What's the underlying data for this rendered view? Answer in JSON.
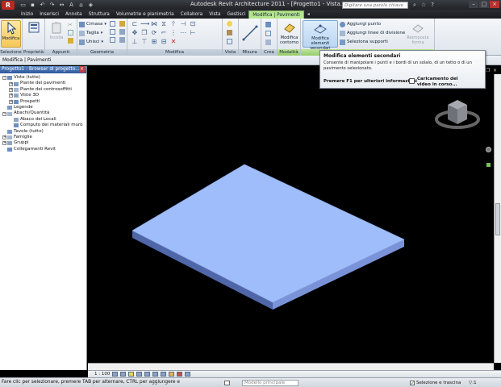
{
  "window": {
    "title": "Autodesk Revit Architecture 2011 - [Progetto1 - Vista...",
    "search_placeholder": "Digitare una parola chiave o una frase",
    "app_logo": "R"
  },
  "tabs": [
    {
      "label": "Inizio",
      "active": false
    },
    {
      "label": "Inserisci",
      "active": false
    },
    {
      "label": "Annota",
      "active": false
    },
    {
      "label": "Struttura",
      "active": false
    },
    {
      "label": "Volumetrie e planimetria",
      "active": false
    },
    {
      "label": "Collabora",
      "active": false
    },
    {
      "label": "Vista",
      "active": false
    },
    {
      "label": "Gestisci",
      "active": false
    },
    {
      "label": "Modifica | Pavimenti",
      "active": true
    }
  ],
  "ribbon": {
    "modifica_button": "Modifica",
    "panels": {
      "selezione": "Selezione",
      "proprieta": "Proprietà",
      "appunti": "Appunti",
      "geometria": "Geometria",
      "modifica": "Modifica",
      "vista": "Vista",
      "misura": "Misura",
      "crea": "Crea",
      "modalita": "Modalità"
    },
    "incolla_label": "Incolla",
    "geometry_items": [
      "Cimasa",
      "Taglia",
      "Unisci"
    ],
    "modifica_contorno": "Modifica contorno",
    "modifica_secondari": "Modifica elementi secondari",
    "shape_items": [
      "Aggiungi punto",
      "Aggiungi linee di divisione",
      "Seleziona supporti"
    ],
    "reimposta_forma": "Reimposta forma"
  },
  "context_bar": {
    "text": "Modifica | Pavimenti"
  },
  "tooltip": {
    "title": "Modifica elementi secondari",
    "description": "Consente di manipolare i punti e i bordi di un solaio, di un tetto o di un pavimento selezionato.",
    "f1": "Premere F1 per ulteriori informazioni",
    "video": "Caricamento del video in corso..."
  },
  "browser": {
    "title": "Progetto1 - Browser di progetto...",
    "close": "×",
    "tree": [
      {
        "label": "Viste (tutto)",
        "level": 0,
        "expander": "−"
      },
      {
        "label": "Piante dei pavimenti",
        "level": 1,
        "expander": "+"
      },
      {
        "label": "Piante dei controsoffitti",
        "level": 1,
        "expander": "+"
      },
      {
        "label": "Viste 3D",
        "level": 1,
        "expander": "+"
      },
      {
        "label": "Prospetti",
        "level": 1,
        "expander": "+"
      },
      {
        "label": "Legende",
        "level": 0,
        "expander": ""
      },
      {
        "label": "Abachi/Quantità",
        "level": 0,
        "expander": "−"
      },
      {
        "label": "Abaco dei Locali",
        "level": 1,
        "expander": ""
      },
      {
        "label": "Computo dei materiali muro",
        "level": 1,
        "expander": ""
      },
      {
        "label": "Tavole (tutto)",
        "level": 0,
        "expander": ""
      },
      {
        "label": "Famiglie",
        "level": 0,
        "expander": "+"
      },
      {
        "label": "Gruppi",
        "level": 0,
        "expander": "+"
      },
      {
        "label": "Collegamenti Revit",
        "level": 0,
        "expander": ""
      }
    ]
  },
  "viewbar": {
    "scale": "1 : 100"
  },
  "status": {
    "text": "Fare clic per selezionare, premere TAB per alternare, CTRL per aggiungere e",
    "model_dropdown": "Modello principale",
    "select_drag": "Selezione e trascina",
    "filter": ":1"
  },
  "colors": {
    "floor_top": "#9fbdfa",
    "floor_side": "#5f78bd",
    "active_tab": "#b6e58f",
    "viewport_bg": "#000000"
  }
}
